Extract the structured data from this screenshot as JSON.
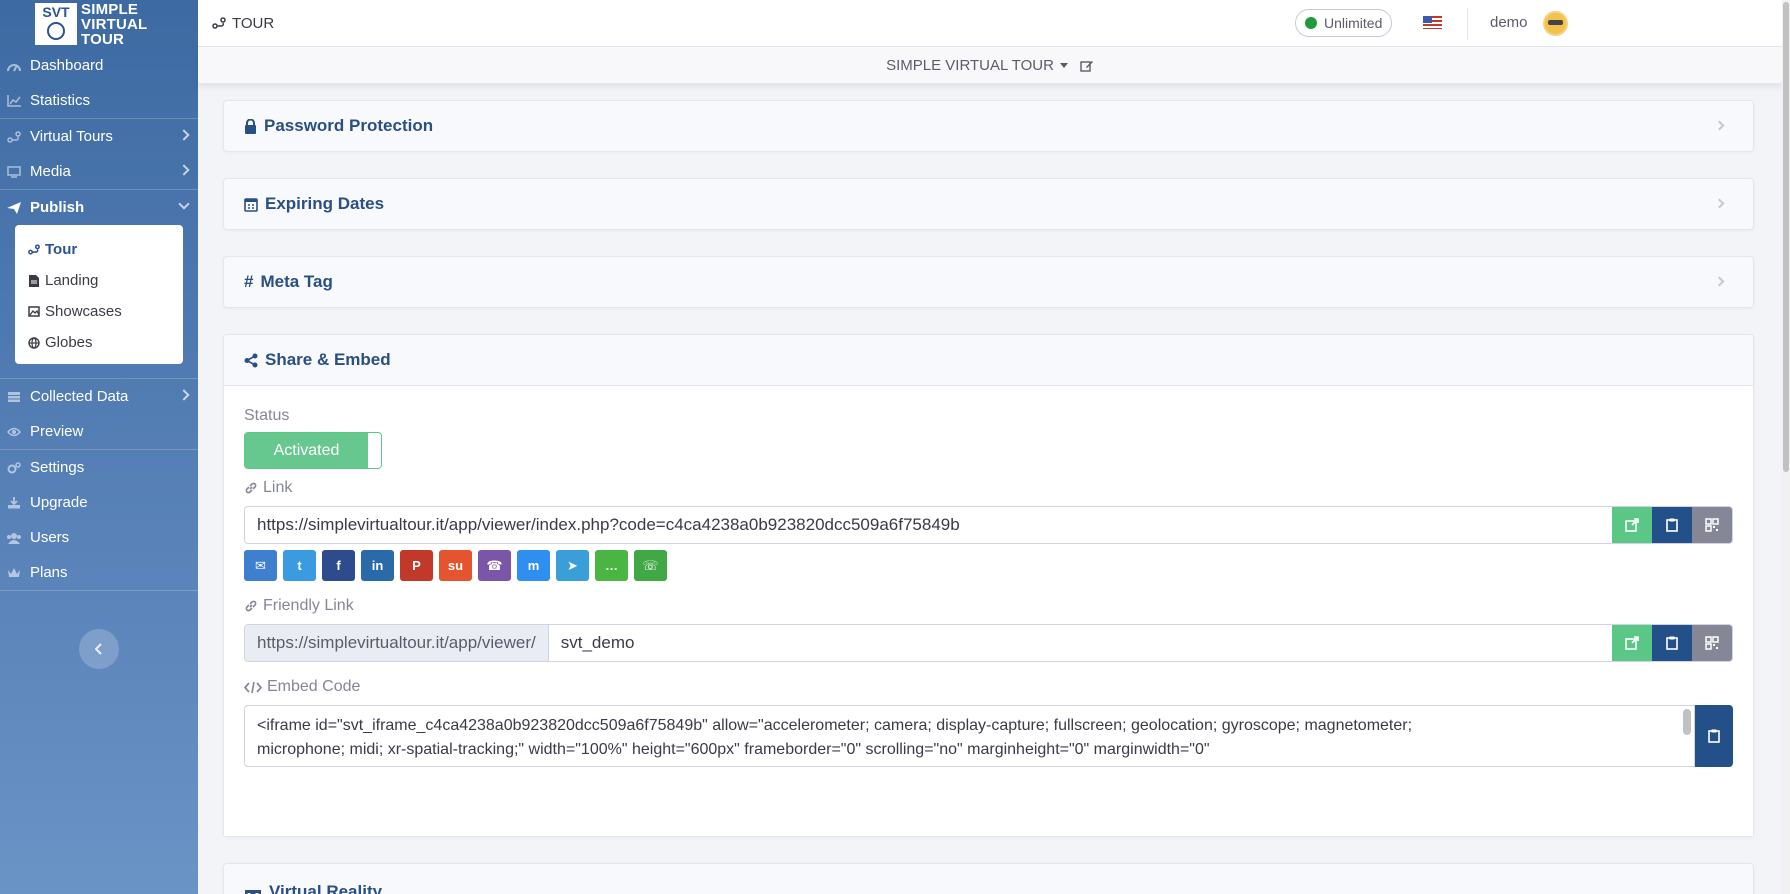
{
  "app": {
    "logo_top": "SVT",
    "logo_text": "SIMPLE VIRTUAL TOUR",
    "page_crumb": "TOUR",
    "plan_badge": "Unlimited",
    "user": "demo",
    "tour_selector": "SIMPLE VIRTUAL TOUR"
  },
  "sidebar": {
    "items": [
      {
        "label": "Dashboard",
        "icon": "gauge-icon"
      },
      {
        "label": "Statistics",
        "icon": "chart-icon"
      },
      {
        "label": "Virtual Tours",
        "icon": "route-icon"
      },
      {
        "label": "Media",
        "icon": "monitor-icon"
      },
      {
        "label": "Publish",
        "icon": "paper-plane-icon"
      },
      {
        "label": "Collected Data",
        "icon": "database-icon"
      },
      {
        "label": "Preview",
        "icon": "eye-icon"
      },
      {
        "label": "Settings",
        "icon": "gears-icon"
      },
      {
        "label": "Upgrade",
        "icon": "download-icon"
      },
      {
        "label": "Users",
        "icon": "users-icon"
      },
      {
        "label": "Plans",
        "icon": "crown-icon"
      }
    ],
    "submenu": [
      {
        "label": "Tour",
        "icon": "route-icon"
      },
      {
        "label": "Landing",
        "icon": "file-icon"
      },
      {
        "label": "Showcases",
        "icon": "images-icon"
      },
      {
        "label": "Globes",
        "icon": "globe-icon"
      }
    ]
  },
  "sections": {
    "password": "Password Protection",
    "expiring": "Expiring Dates",
    "meta": "Meta Tag",
    "share": "Share & Embed",
    "vr": "Virtual Reality"
  },
  "share": {
    "status_label": "Status",
    "status_value": "Activated",
    "link_label": "Link",
    "link_value": "https://simplevirtualtour.it/app/viewer/index.php?code=c4ca4238a0b923820dcc509a6f75849b",
    "friendly_label": "Friendly Link",
    "friendly_prefix": "https://simplevirtualtour.it/app/viewer/",
    "friendly_value": "svt_demo",
    "embed_label": "Embed Code",
    "embed_line1": "<iframe id=\"svt_iframe_c4ca4238a0b923820dcc509a6f75849b\" allow=\"accelerometer; camera; display-capture; fullscreen; geolocation; gyroscope; magnetometer;",
    "embed_line2": "microphone; midi; xr-spatial-tracking;\" width=\"100%\" height=\"600px\" frameborder=\"0\" scrolling=\"no\" marginheight=\"0\" marginwidth=\"0\"",
    "social": [
      {
        "name": "email",
        "color": "#3f7fd0"
      },
      {
        "name": "twitter",
        "color": "#3b9be0"
      },
      {
        "name": "facebook",
        "color": "#2e4b8e"
      },
      {
        "name": "linkedin",
        "color": "#2a6aa8"
      },
      {
        "name": "pinterest",
        "color": "#c0392b"
      },
      {
        "name": "stumbleupon",
        "color": "#e4542e"
      },
      {
        "name": "viber",
        "color": "#7b55a8"
      },
      {
        "name": "messenger",
        "color": "#2f8ff0"
      },
      {
        "name": "telegram",
        "color": "#3a9ed8"
      },
      {
        "name": "sms",
        "color": "#4bb543"
      },
      {
        "name": "whatsapp",
        "color": "#40a845"
      }
    ]
  },
  "colors": {
    "sidebar_top": "#3e6aa3",
    "sidebar_bottom": "#6a93c6",
    "heading": "#2a4f82",
    "success": "#5bc786",
    "primary": "#24508a"
  }
}
